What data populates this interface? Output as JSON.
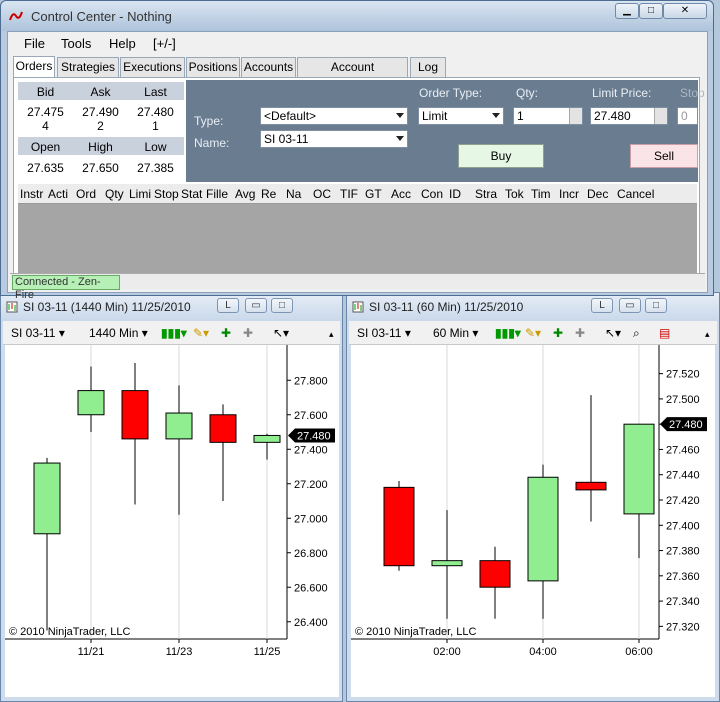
{
  "control_center": {
    "title": "Control Center - Nothing",
    "menu": [
      "File",
      "Tools",
      "Help",
      "[+/-]"
    ],
    "tabs": [
      "Orders",
      "Strategies",
      "Executions",
      "Positions",
      "Accounts",
      "Account Performance",
      "Log"
    ],
    "active_tab": "Orders",
    "quote": {
      "bid_label": "Bid",
      "ask_label": "Ask",
      "last_label": "Last",
      "bid": "27.475",
      "ask": "27.490",
      "last": "27.480",
      "bid_size": "4",
      "ask_size": "2",
      "last_size": "1",
      "open_label": "Open",
      "high_label": "High",
      "low_label": "Low",
      "open": "27.635",
      "high": "27.650",
      "low": "27.385"
    },
    "order": {
      "type_label": "Type:",
      "type_value": "<Default>",
      "name_label": "Name:",
      "name_value": "SI 03-11",
      "order_type_label": "Order Type:",
      "order_type_value": "Limit",
      "qty_label": "Qty:",
      "qty_value": "1",
      "limit_label": "Limit Price:",
      "limit_value": "27.480",
      "stop_label": "Stop",
      "stop_value": "0",
      "buy_label": "Buy",
      "sell_label": "Sell"
    },
    "grid_columns": [
      "Instr",
      "Acti",
      "Ord",
      "Qty",
      "Limi",
      "Stop",
      "Stat",
      "Fille",
      "Avg",
      "Re",
      "Na",
      "OC",
      "TIF",
      "GT",
      "Acc",
      "Con",
      "ID",
      "Stra",
      "Tok",
      "Tim",
      "Incr",
      "Dec",
      "Cancel"
    ],
    "status": "Connected - Zen-Fire"
  },
  "chart_left": {
    "title": "SI 03-11 (1440 Min)  11/25/2010",
    "instrument": "SI 03-11",
    "interval": "1440 Min",
    "copyright": "© 2010 NinjaTrader, LLC",
    "last_price_label": "27.480"
  },
  "chart_right": {
    "title": "SI 03-11 (60 Min)  11/25/2010",
    "instrument": "SI 03-11",
    "interval": "60 Min",
    "copyright": "© 2010 NinjaTrader, LLC",
    "last_price_label": "27.480"
  },
  "colors": {
    "up": "#90ee90",
    "down": "#ff0000",
    "panel": "#6a7c90"
  },
  "chart_data": [
    {
      "type": "candlestick",
      "title": "SI 03-11 (1440 Min)  11/25/2010",
      "ylim": [
        26.3,
        27.9
      ],
      "yticks": [
        "27.800",
        "27.600",
        "27.400",
        "27.200",
        "27.000",
        "26.800",
        "26.600",
        "26.400"
      ],
      "xticks": [
        "11/21",
        "11/23",
        "11/25"
      ],
      "candles": [
        {
          "o": 26.91,
          "h": 27.35,
          "l": 26.35,
          "c": 27.32
        },
        {
          "o": 27.6,
          "h": 27.88,
          "l": 27.5,
          "c": 27.74
        },
        {
          "o": 27.74,
          "h": 27.9,
          "l": 27.08,
          "c": 27.46
        },
        {
          "o": 27.46,
          "h": 27.77,
          "l": 27.02,
          "c": 27.61
        },
        {
          "o": 27.6,
          "h": 27.66,
          "l": 27.1,
          "c": 27.44
        },
        {
          "o": 27.44,
          "h": 27.49,
          "l": 27.34,
          "c": 27.48
        }
      ]
    },
    {
      "type": "candlestick",
      "title": "SI 03-11 (60 Min)  11/25/2010",
      "ylim": [
        27.31,
        27.53
      ],
      "yticks": [
        "27.520",
        "27.500",
        "27.480",
        "27.460",
        "27.440",
        "27.420",
        "27.400",
        "27.380",
        "27.360",
        "27.340",
        "27.320"
      ],
      "xticks": [
        "02:00",
        "04:00",
        "06:00"
      ],
      "candles": [
        {
          "o": 27.43,
          "h": 27.435,
          "l": 27.364,
          "c": 27.368
        },
        {
          "o": 27.368,
          "h": 27.412,
          "l": 27.326,
          "c": 27.372
        },
        {
          "o": 27.372,
          "h": 27.383,
          "l": 27.326,
          "c": 27.351
        },
        {
          "o": 27.356,
          "h": 27.448,
          "l": 27.326,
          "c": 27.438
        },
        {
          "o": 27.434,
          "h": 27.503,
          "l": 27.403,
          "c": 27.428
        },
        {
          "o": 27.409,
          "h": 27.48,
          "l": 27.374,
          "c": 27.48
        }
      ]
    }
  ]
}
